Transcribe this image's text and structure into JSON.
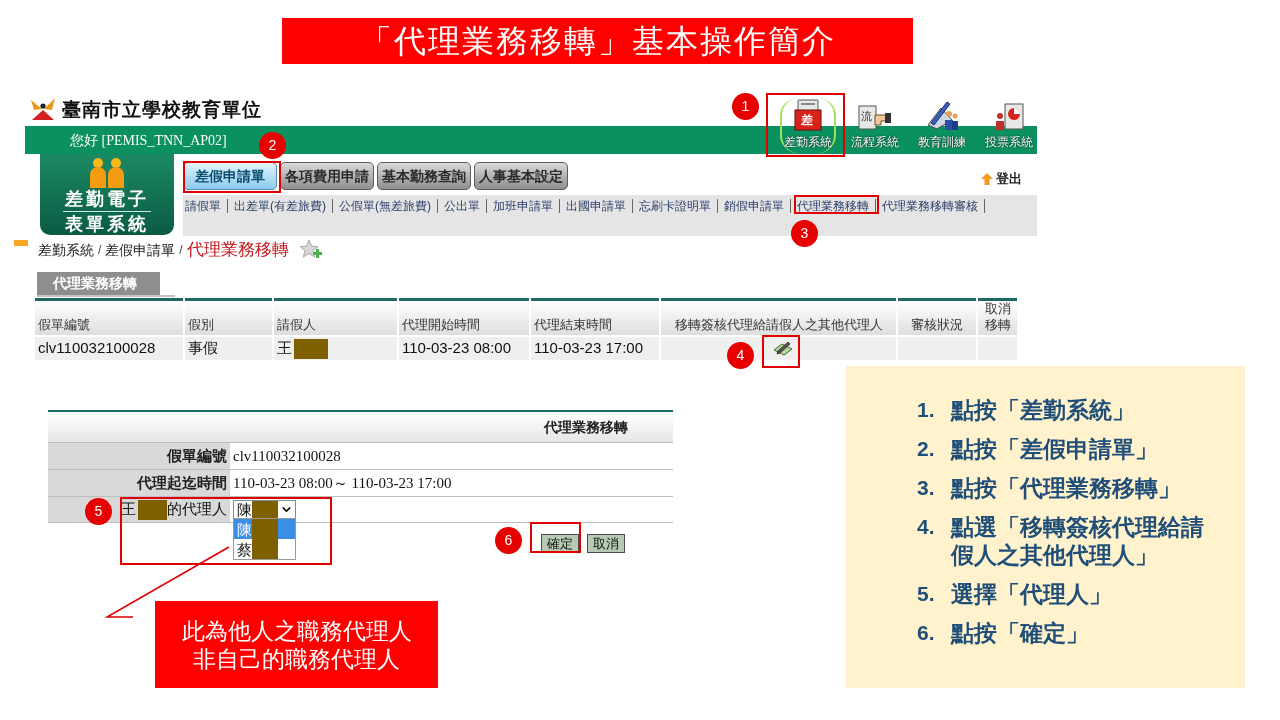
{
  "title": "「代理業務移轉」基本操作簡介",
  "header": {
    "site_title": "臺南市立學校教育單位",
    "greeting": "您好 [PEMIS_TNN_AP02]",
    "systems": [
      {
        "kind": "attendance",
        "icon_text": "差",
        "label": "差勤系統",
        "selected": true
      },
      {
        "kind": "workflow",
        "icon_text": "流",
        "label": "流程系統",
        "selected": false
      },
      {
        "kind": "training",
        "label": "教育訓練",
        "selected": false
      },
      {
        "kind": "voting",
        "label": "投票系統",
        "selected": false
      }
    ],
    "logo_lines": [
      "差勤電子",
      "表單系統"
    ],
    "tabs": [
      {
        "label": "差假申請單",
        "selected": true
      },
      {
        "label": "各項費用申請",
        "selected": false
      },
      {
        "label": "基本勤務查詢",
        "selected": false
      },
      {
        "label": "人事基本設定",
        "selected": false
      }
    ],
    "logout": "登出",
    "links": [
      "請假單",
      "出差單(有差旅費)",
      "公假單(無差旅費)",
      "公出單",
      "加班申請單",
      "出國申請單",
      "忘刷卡證明單",
      "銷假申請單",
      "代理業務移轉",
      "代理業務移轉審核"
    ]
  },
  "content": {
    "breadcrumb": [
      {
        "kind": "link",
        "text": "差勤系統"
      },
      {
        "kind": "separator",
        "text": "/"
      },
      {
        "kind": "link",
        "text": "差假申請單"
      },
      {
        "kind": "separator",
        "text": "/"
      },
      {
        "kind": "current",
        "text": "代理業務移轉"
      }
    ],
    "panel_tab": "代理業務移轉",
    "table": {
      "columns": [
        "假單編號",
        "假別",
        "請假人",
        "代理開始時間",
        "代理結束時間",
        "移轉簽核代理給請假人之其他代理人",
        "審核狀況",
        "取消移轉"
      ],
      "rows": [
        {
          "id": "clv110032100028",
          "leave_type": "事假",
          "applicant": {
            "name": "王",
            "redacted": true
          },
          "start": "110-03-23 08:00",
          "end": "110-03-23 17:00"
        }
      ]
    }
  },
  "form": {
    "heading": "代理業務移轉",
    "rows": [
      {
        "kind": "text",
        "label": "假單編號",
        "value": "clv110032100028"
      },
      {
        "kind": "text",
        "label": "代理起迄時間",
        "value": "110-03-23 08:00～ 110-03-23 17:00"
      },
      {
        "kind": "select",
        "label": {
          "name": "王",
          "redacted": true,
          "suffix": "的代理人"
        },
        "value": {
          "name": "陳",
          "redacted": true
        },
        "expanded": true,
        "options": [
          {
            "name": "陳",
            "redacted": true,
            "selected": true
          },
          {
            "name": "蔡",
            "redacted": true,
            "selected": false
          }
        ]
      }
    ],
    "buttons": [
      "確定",
      "取消"
    ]
  },
  "markers": [
    "1",
    "2",
    "3",
    "4",
    "5",
    "6"
  ],
  "note": [
    "此為他人之職務代理人",
    "非自己的職務代理人"
  ],
  "steps": [
    {
      "number": "1.",
      "text": "點按「差勤系統」"
    },
    {
      "number": "2.",
      "text": "點按「差假申請單」"
    },
    {
      "number": "3.",
      "text": "點按「代理業務移轉」"
    },
    {
      "number": "4.",
      "text": "點選「移轉簽核代理給請假人之其他代理人」"
    },
    {
      "number": "5.",
      "text": "選擇「代理人」"
    },
    {
      "number": "6.",
      "text": "點按「確定」"
    }
  ]
}
